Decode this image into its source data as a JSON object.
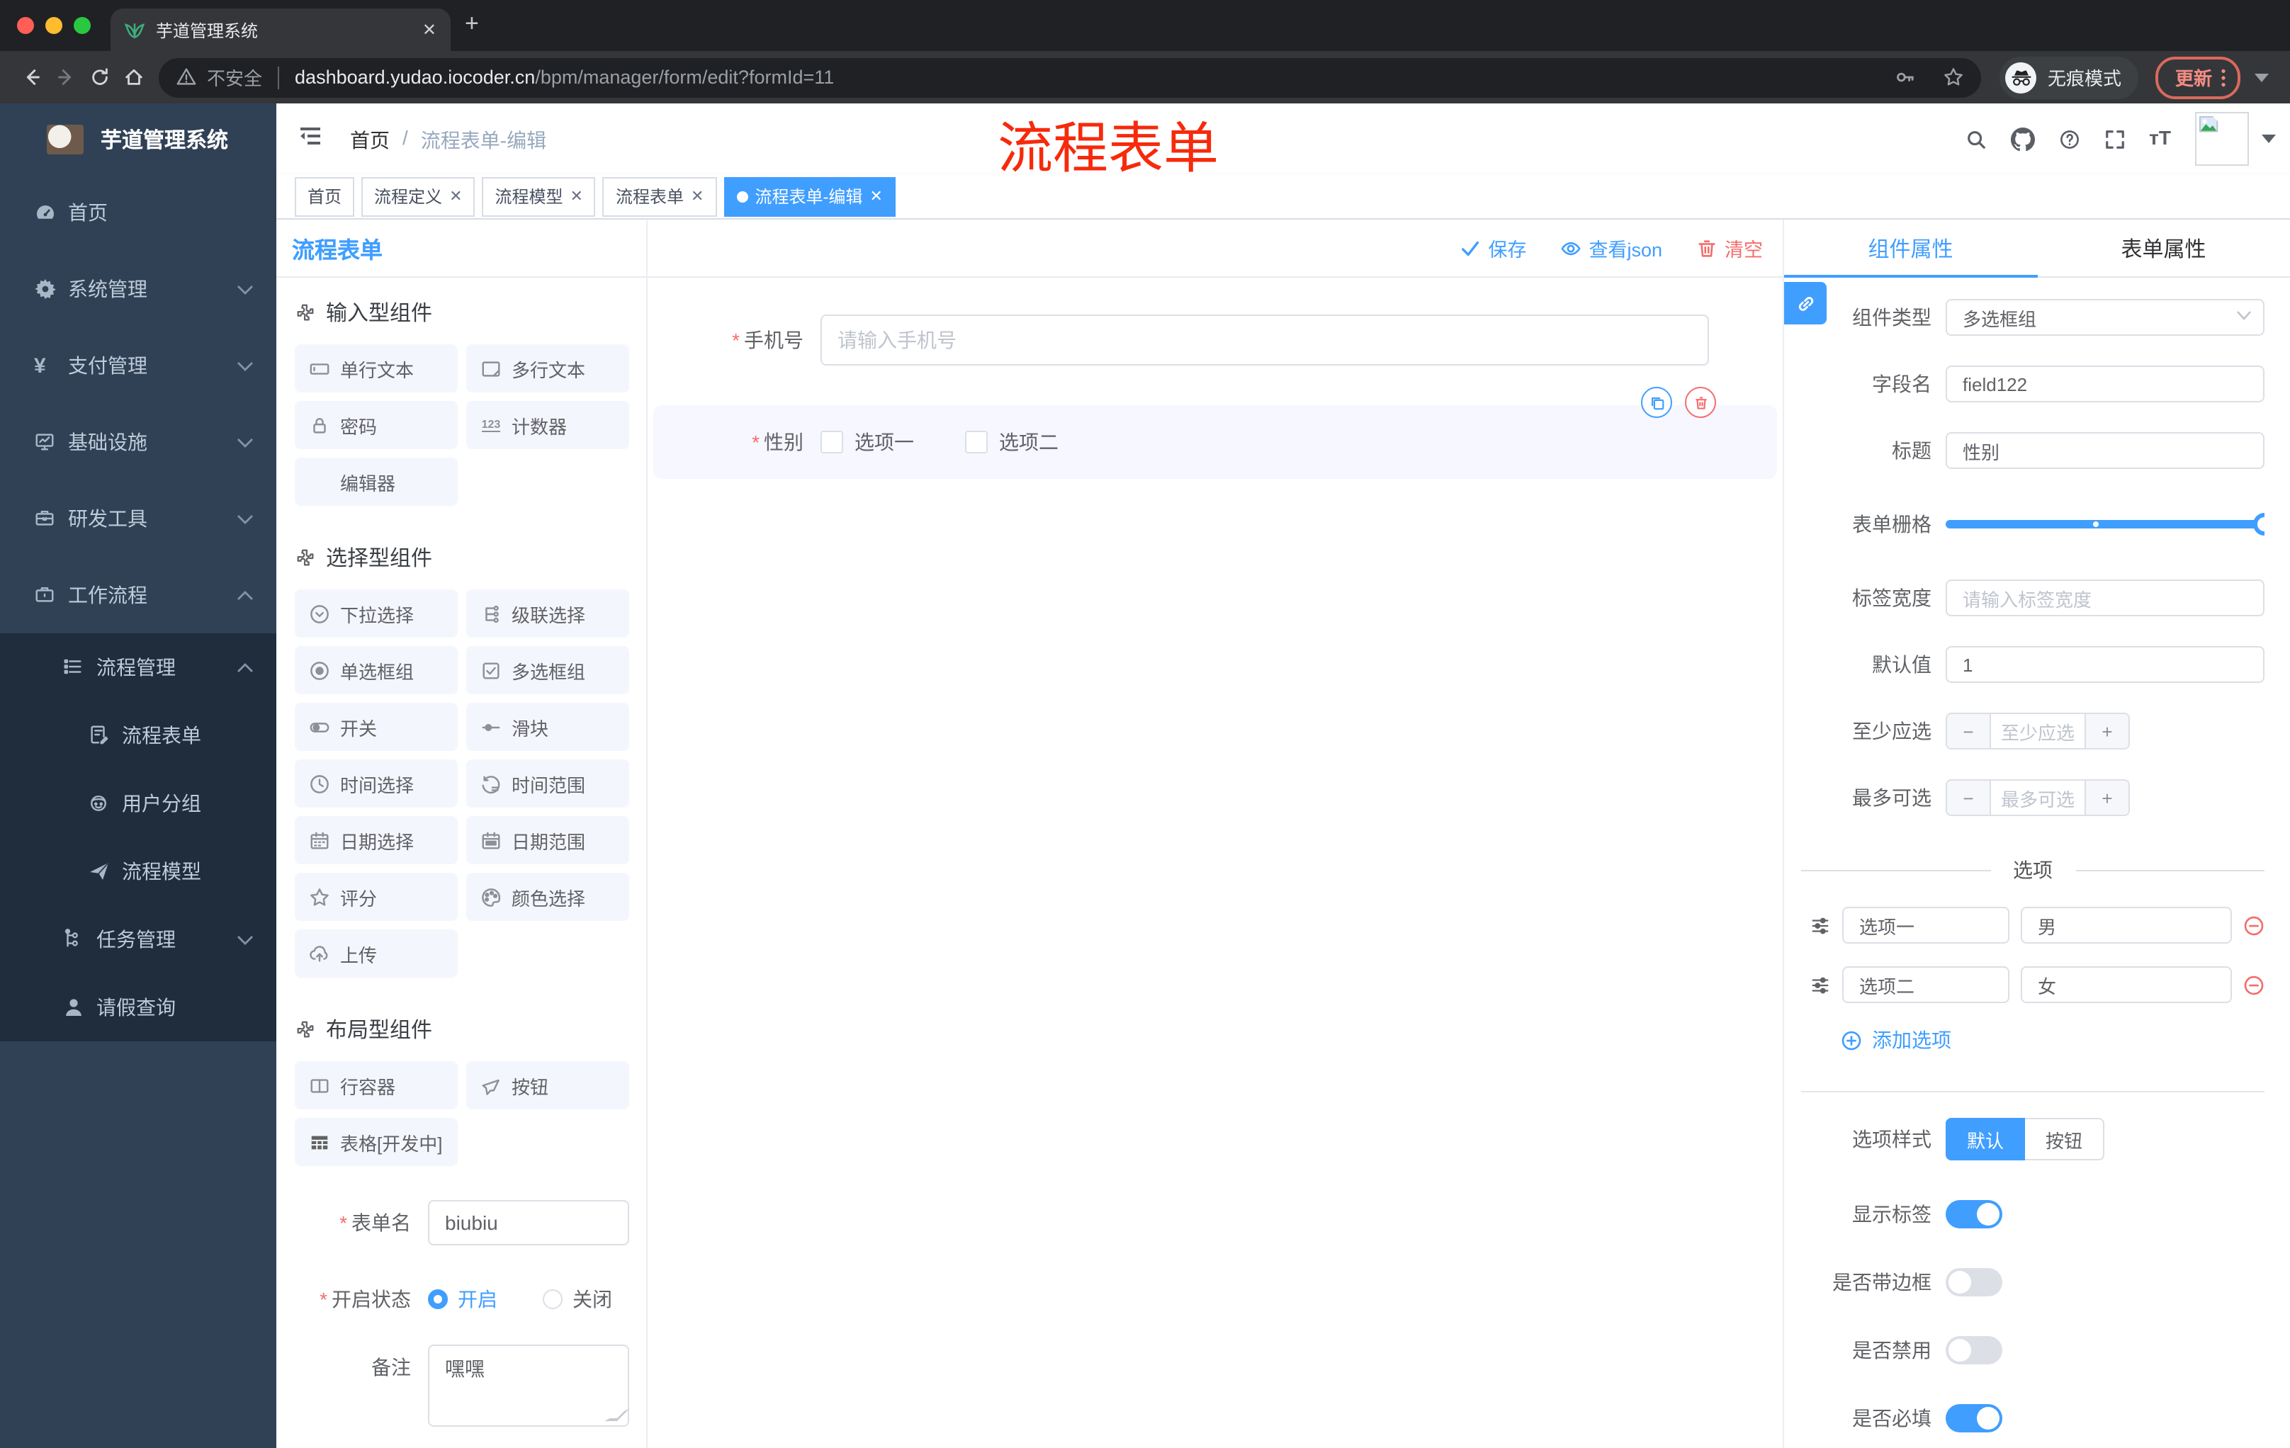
{
  "browser": {
    "tab_title": "芋道管理系统",
    "new_tab": "+",
    "security_label": "不安全",
    "url_host": "dashboard.yudao.iocoder.cn",
    "url_path": "/bpm/manager/form/edit?formId=11",
    "incognito_label": "无痕模式",
    "update_label": "更新"
  },
  "annotation": {
    "text": "流程表单",
    "color": "#f62a0c"
  },
  "sidebar": {
    "logo_title": "芋道管理系统",
    "items": [
      {
        "label": "首页",
        "icon": "dashboard",
        "level": 0,
        "chevron": "",
        "dark": false
      },
      {
        "label": "系统管理",
        "icon": "gear",
        "level": 0,
        "chevron": "down",
        "dark": false
      },
      {
        "label": "支付管理",
        "icon": "yen",
        "level": 0,
        "chevron": "down",
        "dark": false
      },
      {
        "label": "基础设施",
        "icon": "monitor",
        "level": 0,
        "chevron": "down",
        "dark": false
      },
      {
        "label": "研发工具",
        "icon": "toolbox",
        "level": 0,
        "chevron": "down",
        "dark": false
      },
      {
        "label": "工作流程",
        "icon": "briefcase",
        "level": 0,
        "chevron": "up",
        "dark": false
      },
      {
        "label": "流程管理",
        "icon": "treelist",
        "level": 1,
        "chevron": "up",
        "dark": true
      },
      {
        "label": "流程表单",
        "icon": "docedit",
        "level": 2,
        "chevron": "",
        "dark": true
      },
      {
        "label": "用户分组",
        "icon": "robot",
        "level": 2,
        "chevron": "",
        "dark": true
      },
      {
        "label": "流程模型",
        "icon": "plane",
        "level": 2,
        "chevron": "",
        "dark": true
      },
      {
        "label": "任务管理",
        "icon": "tree",
        "level": 1,
        "chevron": "down",
        "dark": true
      },
      {
        "label": "请假查询",
        "icon": "user",
        "level": 1,
        "chevron": "",
        "dark": true
      }
    ]
  },
  "header": {
    "breadcrumb_home": "首页",
    "breadcrumb_sep": "/",
    "breadcrumb_current": "流程表单-编辑"
  },
  "tags": [
    {
      "label": "首页",
      "closable": false,
      "active": false
    },
    {
      "label": "流程定义",
      "closable": true,
      "active": false
    },
    {
      "label": "流程模型",
      "closable": true,
      "active": false
    },
    {
      "label": "流程表单",
      "closable": true,
      "active": false
    },
    {
      "label": "流程表单-编辑",
      "closable": true,
      "active": true
    }
  ],
  "builder": {
    "panel_title": "流程表单",
    "toolbar": {
      "save": "保存",
      "view_json": "查看json",
      "clear": "清空"
    },
    "sections": [
      {
        "title": "输入型组件",
        "items": [
          {
            "label": "单行文本",
            "icon": "inputbox"
          },
          {
            "label": "多行文本",
            "icon": "textarea"
          },
          {
            "label": "密码",
            "icon": "lock"
          },
          {
            "label": "计数器",
            "icon": "counter"
          },
          {
            "label": "编辑器",
            "icon": "none"
          }
        ]
      },
      {
        "title": "选择型组件",
        "items": [
          {
            "label": "下拉选择",
            "icon": "selectdown"
          },
          {
            "label": "级联选择",
            "icon": "cascade"
          },
          {
            "label": "单选框组",
            "icon": "radioicon"
          },
          {
            "label": "多选框组",
            "icon": "checksq"
          },
          {
            "label": "开关",
            "icon": "switchic"
          },
          {
            "label": "滑块",
            "icon": "slideric"
          },
          {
            "label": "时间选择",
            "icon": "clock"
          },
          {
            "label": "时间范围",
            "icon": "timerange"
          },
          {
            "label": "日期选择",
            "icon": "calendar"
          },
          {
            "label": "日期范围",
            "icon": "daterange"
          },
          {
            "label": "评分",
            "icon": "star"
          },
          {
            "label": "颜色选择",
            "icon": "palette"
          },
          {
            "label": "上传",
            "icon": "upload"
          }
        ]
      },
      {
        "title": "布局型组件",
        "items": [
          {
            "label": "行容器",
            "icon": "rowbox"
          },
          {
            "label": "按钮",
            "icon": "pointer"
          },
          {
            "label": "表格[开发中]",
            "icon": "tableic"
          }
        ]
      }
    ],
    "form": {
      "name_label": "表单名",
      "name_value": "biubiu",
      "status_label": "开启状态",
      "status_on": "开启",
      "status_off": "关闭",
      "remark_label": "备注",
      "remark_value": "嘿嘿"
    },
    "canvas": {
      "phone_label": "手机号",
      "phone_placeholder": "请输入手机号",
      "gender_label": "性别",
      "gender_options": [
        "选项一",
        "选项二"
      ]
    }
  },
  "inspector": {
    "tab_component": "组件属性",
    "tab_form": "表单属性",
    "component_type_label": "组件类型",
    "component_type_value": "多选框组",
    "field_label": "字段名",
    "field_value": "field122",
    "title_label": "标题",
    "title_value": "性别",
    "grid_label": "表单栅格",
    "label_width_label": "标签宽度",
    "label_width_placeholder": "请输入标签宽度",
    "default_label": "默认值",
    "default_value": "1",
    "min_label": "至少应选",
    "min_placeholder": "至少应选",
    "max_label": "最多可选",
    "max_placeholder": "最多可选",
    "options_divider": "选项",
    "options": [
      {
        "label": "选项一",
        "value": "男"
      },
      {
        "label": "选项二",
        "value": "女"
      }
    ],
    "add_option": "添加选项",
    "style_label": "选项样式",
    "style_default": "默认",
    "style_button": "按钮",
    "switches": [
      {
        "label": "显示标签",
        "on": true
      },
      {
        "label": "是否带边框",
        "on": false
      },
      {
        "label": "是否禁用",
        "on": false
      },
      {
        "label": "是否必填",
        "on": true
      }
    ]
  },
  "colors": {
    "primary": "#409EFF",
    "danger": "#F56C6C",
    "sidebar": "#304156",
    "sidebar_sub": "#1f2d3d",
    "annotation": "#f62a0c"
  }
}
